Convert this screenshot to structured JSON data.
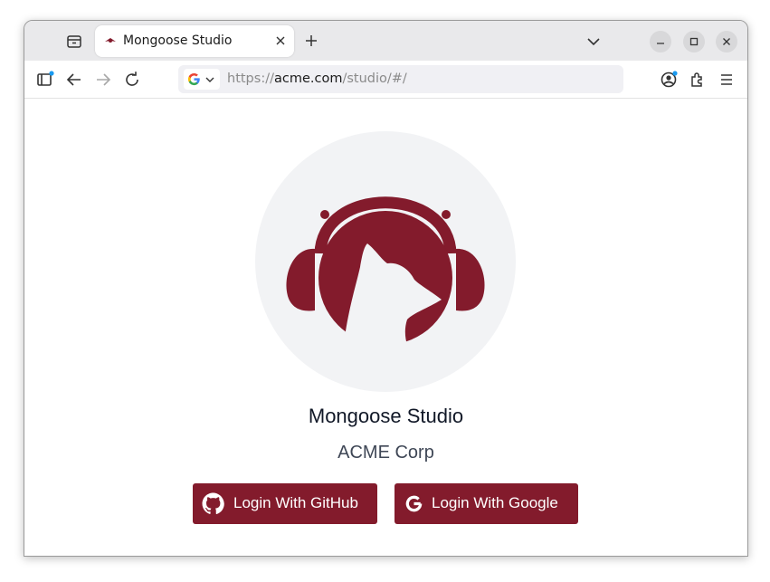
{
  "browser": {
    "tab": {
      "title": "Mongoose Studio"
    },
    "url": {
      "scheme": "https://",
      "host": "acme.com",
      "path": "/studio/#/"
    },
    "search_engine_icon": "google-g-icon"
  },
  "page": {
    "logo_icon": "mongoose-headphones-logo",
    "title": "Mongoose Studio",
    "org_name": "ACME Corp",
    "buttons": {
      "github_label": "Login With GitHub",
      "google_label": "Login With Google"
    }
  },
  "colors": {
    "brand": "#831b2c",
    "logo_background": "#f2f3f5",
    "tabbar_background": "#e9e9eb",
    "urlbar_background": "#f0f0f4"
  }
}
